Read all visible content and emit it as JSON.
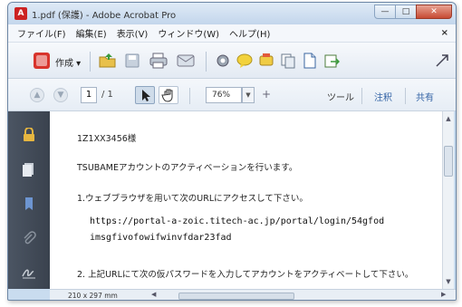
{
  "window": {
    "title": "1.pdf (保護) - Adobe Acrobat Pro",
    "min_label": "—",
    "max_label": "□",
    "close_label": "✕"
  },
  "menu": {
    "items": [
      "ファイル(F)",
      "編集(E)",
      "表示(V)",
      "ウィンドウ(W)",
      "ヘルプ(H)"
    ],
    "close_doc": "×"
  },
  "toolbar": {
    "create_label": "作成 ▾",
    "icons": [
      "create-icon",
      "open-folder-icon",
      "save-icon",
      "print-icon",
      "email-icon",
      "settings-icon",
      "comment-icon",
      "stamp-icon",
      "pages-icon",
      "document-icon",
      "export-icon",
      "expand-icon"
    ]
  },
  "nav": {
    "page_current": "1",
    "page_total": "/ 1",
    "zoom": "76%",
    "tools_label": "ツール",
    "comment_label": "注釈",
    "share_label": "共有"
  },
  "document": {
    "lines": [
      "1Z1XX3456様",
      "TSUBAMEアカウントのアクティベーションを行います。",
      "1.ウェブブラウザを用いて次のURLにアクセスして下さい。",
      "https://portal-a-zoic.titech-ac.jp/portal/login/54gfod",
      "imsgfivofowifwinvfdar23fad",
      "2. 上記URLにて次の仮パスワードを入力してアカウントをアクティベートして下さい。"
    ]
  },
  "status": {
    "page_size": "210 x 297 mm"
  },
  "colors": {
    "leftnav": "#3a424e",
    "close_button": "#c74a33",
    "accent_blue": "#3464a6"
  }
}
